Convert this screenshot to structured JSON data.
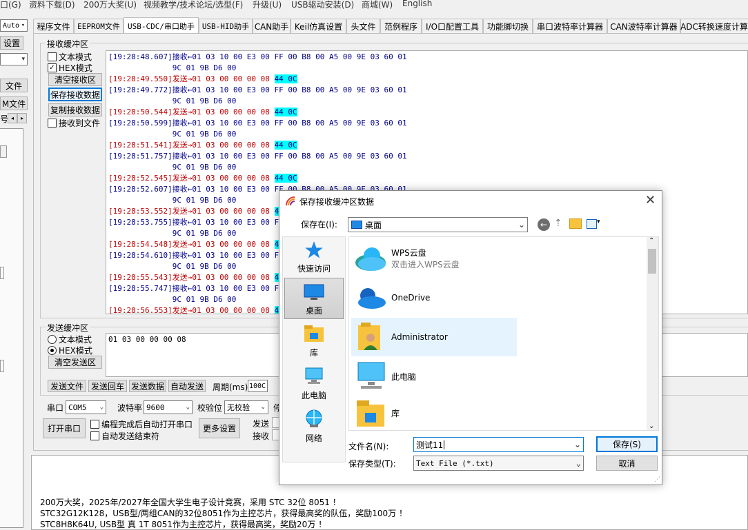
{
  "menubar": {
    "items": [
      "口(G)",
      "资料下载(D)",
      "200万大奖(U)",
      "视频教学/技术论坛/选型(F)",
      "升级(U)",
      "USB驱动安装(D)",
      "商城(W)",
      "English"
    ]
  },
  "left_panel": {
    "auto_label": "Auto",
    "settings_label": "设置",
    "file_label1": "文件",
    "file_label2": "M文件",
    "num_label": "号"
  },
  "tabs": [
    "程序文件",
    "EEPROM文件",
    "USB-CDC/串口助手",
    "USB-HID助手",
    "CAN助手",
    "Keil仿真设置",
    "头文件",
    "范例程序",
    "I/O口配置工具",
    "功能脚切换",
    "串口波特率计算器",
    "CAN波特率计算器",
    "ADC转换速度计算器"
  ],
  "receive": {
    "group_label": "接收缓冲区",
    "text_mode": "文本模式",
    "hex_mode": "HEX模式",
    "clear_btn": "清空接收区",
    "save_btn": "保存接收数据",
    "copy_btn": "复制接收数据",
    "to_file": "接收到文件",
    "lines": [
      {
        "type": "recv",
        "text": "[19:28:48.607]接收←01 03 10 00 E3 00 FF 00 B8 00 A5 00 9E 03 60 01"
      },
      {
        "type": "cont",
        "text": "              9C 01 9B D6 00"
      },
      {
        "type": "send",
        "text": "[19:28:49.550]发送→01 03 00 00 00 08 ",
        "hl": "44 0C"
      },
      {
        "type": "recv",
        "text": "[19:28:49.772]接收←01 03 10 00 E3 00 FF 00 B8 00 A5 00 9E 03 60 01"
      },
      {
        "type": "cont",
        "text": "              9C 01 9B D6 00"
      },
      {
        "type": "send",
        "text": "[19:28:50.544]发送→01 03 00 00 00 08 ",
        "hl": "44 0C"
      },
      {
        "type": "recv",
        "text": "[19:28:50.599]接收←01 03 10 00 E3 00 FF 00 B8 00 A5 00 9E 03 60 01"
      },
      {
        "type": "cont",
        "text": "              9C 01 9B D6 00"
      },
      {
        "type": "send",
        "text": "[19:28:51.541]发送→01 03 00 00 00 08 ",
        "hl": "44 0C"
      },
      {
        "type": "recv",
        "text": "[19:28:51.757]接收←01 03 10 00 E3 00 FF 00 B8 00 A5 00 9E 03 60 01"
      },
      {
        "type": "cont",
        "text": "              9C 01 9B D6 00"
      },
      {
        "type": "send",
        "text": "[19:28:52.545]发送→01 03 00 00 00 08 ",
        "hl": "44 0C"
      },
      {
        "type": "recv",
        "text": "[19:28:52.607]接收←01 03 10 00 E3 00 FF 00 B8 00 A5 00 9E 03 60 01"
      },
      {
        "type": "cont",
        "text": "              9C 01 9B D6 00"
      },
      {
        "type": "send",
        "text": "[19:28:53.552]发送→01 03 00 00 00 08 ",
        "hl": "44"
      },
      {
        "type": "recv",
        "text": "[19:28:53.755]接收←01 03 10 00 E3 00 FF"
      },
      {
        "type": "cont",
        "text": "              9C 01 9B D6 00"
      },
      {
        "type": "send",
        "text": "[19:28:54.548]发送→01 03 00 00 00 08 ",
        "hl": "4"
      },
      {
        "type": "recv",
        "text": "[19:28:54.610]接收←01 03 10 00 E3 00 FF"
      },
      {
        "type": "cont",
        "text": "              9C 01 9B D6 00"
      },
      {
        "type": "send",
        "text": "[19:28:55.543]发送→01 03 00 00 00 08 ",
        "hl": "4"
      },
      {
        "type": "recv",
        "text": "[19:28:55.747]接收←01 03 10 00 E3 00 FF"
      },
      {
        "type": "cont",
        "text": "              9C 01 9B D6 00"
      },
      {
        "type": "send",
        "text": "[19:28:56.553]发送→01 03 00 00 00 08 ",
        "hl": "4"
      }
    ]
  },
  "send": {
    "group_label": "发送缓冲区",
    "text_mode": "文本模式",
    "hex_mode": "HEX模式",
    "clear_btn": "清空发送区",
    "content": "01 03 00 00 00 08",
    "send_file": "发送文件",
    "send_return": "发送回车",
    "send_data": "发送数据",
    "auto_send": "自动发送",
    "period_label": "周期(ms)",
    "period_value": "100C"
  },
  "port": {
    "port_label": "串口",
    "port_value": "COM5",
    "baud_label": "波特率",
    "baud_value": "9600",
    "parity_label": "校验位",
    "parity_value": "无校验",
    "stop_label": "停",
    "open_btn": "打开串口",
    "auto_open": "编程完成后自动打开串口",
    "auto_send_end": "自动发送结束符",
    "more_btn": "更多设置",
    "send_label": "发送",
    "recv_label": "接收"
  },
  "bottom_text": [
    "200万大奖，2025年/2027年全国大学生电子设计竞赛，采用 STC 32位 8051 ！",
    "STC32G12K128，USB型/两组CAN的32位8051作为主控芯片，获得最高奖的队伍，奖励100万 ！",
    "STC8H8K64U, USB型 真 1T 8051作为主控芯片，获得最高奖，奖励20万 ！"
  ],
  "dialog": {
    "title": "保存接收缓冲区数据",
    "save_in_label": "保存在(I):",
    "save_in_value": "桌面",
    "nav": [
      "快速访问",
      "桌面",
      "库",
      "此电脑",
      "网络"
    ],
    "list": [
      {
        "name": "WPS云盘",
        "sub": "双击进入WPS云盘"
      },
      {
        "name": "OneDrive",
        "sub": ""
      },
      {
        "name": "Administrator",
        "sub": ""
      },
      {
        "name": "此电脑",
        "sub": ""
      },
      {
        "name": "库",
        "sub": ""
      }
    ],
    "filename_label": "文件名(N):",
    "filename_value": "测试11",
    "filetype_label": "保存类型(T):",
    "filetype_value": "Text File (*.txt)",
    "save_btn": "保存(S)",
    "cancel_btn": "取消"
  }
}
